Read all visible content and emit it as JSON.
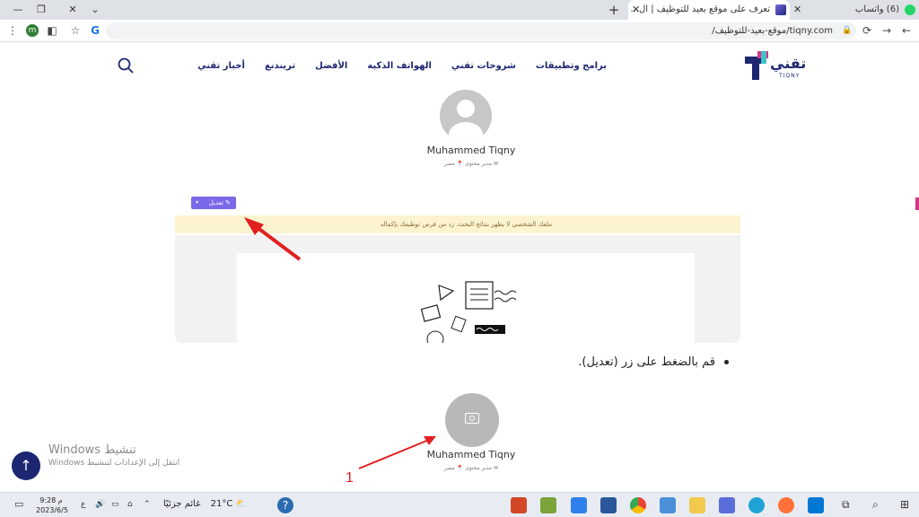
{
  "browser": {
    "active_tab": "تعرف على موقع بعيد للتوظيف | ال...",
    "inactive_tab": "(6) واتساب",
    "url": "tiqny.com/موقع-بعيد-للتوظيف/",
    "profile_letter": "m"
  },
  "site": {
    "logo_text": "تقني",
    "logo_sub": "TIQNY",
    "nav": [
      "أخبار تقني",
      "تريندنغ",
      "الأفضل",
      "الهواتف الذكية",
      "شروحات تقني",
      "برامج وتطبيقات"
    ]
  },
  "profile1": {
    "name": "Muhammed Tiqny",
    "role": "مدير محتوى",
    "location": "مصر",
    "edit_button": "تعديل",
    "notice": "ملفك الشخصي لا يظهر بنتائج البحث. زد من فرص توظيفك بإكماله"
  },
  "instruction": "قم بالضغط على زر (تعديل).",
  "profile2": {
    "name": "Muhammed Tiqny",
    "role": "مدير محتوى",
    "location": "مصر",
    "annotation_number": "1"
  },
  "watermark": {
    "title": "تنشيط Windows",
    "subtitle": "انتقل إلى الإعدادات لتنشيط Windows"
  },
  "taskbar": {
    "time": "9:28 م",
    "date": "2023/6/5",
    "temperature": "21°C",
    "weather": "غائم جزئيًا",
    "lang": "ع"
  },
  "colors": {
    "brand": "#1d2671",
    "edit_button": "#7a69e8",
    "notice_bg": "#fcf3cf",
    "arrow": "#e02020"
  }
}
